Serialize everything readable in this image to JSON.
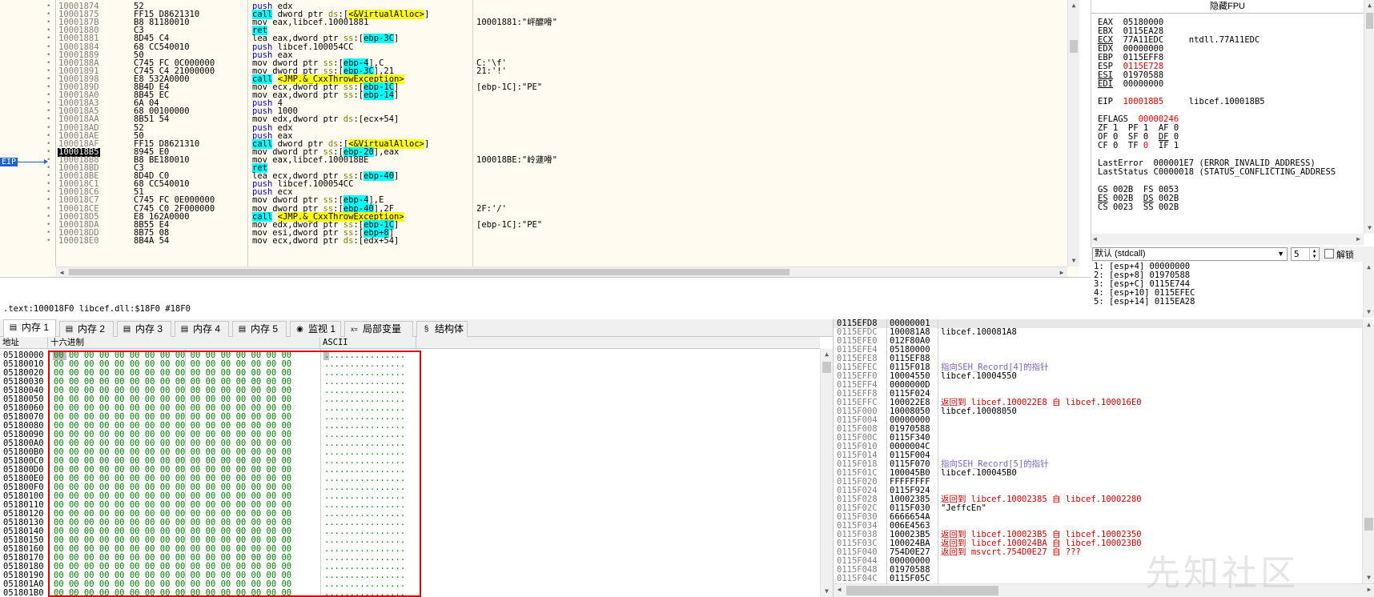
{
  "disasm": {
    "eip_tag": "EIP",
    "rows": [
      {
        "addr": "10001874",
        "bytes": "52",
        "asm": [
          [
            "push",
            "kw-push"
          ],
          [
            " edx",
            ""
          ]
        ],
        "cmt": ""
      },
      {
        "addr": "10001875",
        "bytes": "FF15 D8621310",
        "asm": [
          [
            "call",
            "kw-call"
          ],
          [
            " dword ptr ",
            ""
          ],
          [
            "ds",
            "seg"
          ],
          [
            ":[",
            ""
          ],
          [
            "<&VirtualAlloc>",
            "hl-yel"
          ],
          [
            "]",
            ""
          ]
        ],
        "cmt": ""
      },
      {
        "addr": "1000187B",
        "bytes": "B8 81180010",
        "asm": [
          [
            "mov eax,libcef.10001881",
            ""
          ]
        ],
        "cmt": "10001881:\"岼醿嗗\""
      },
      {
        "addr": "10001880",
        "bytes": "C3",
        "asm": [
          [
            "ret",
            "kw-ret"
          ]
        ],
        "cmt": ""
      },
      {
        "addr": "10001881",
        "bytes": "8D45 C4",
        "asm": [
          [
            "lea eax,dword ptr ",
            ""
          ],
          [
            "ss",
            "seg"
          ],
          [
            ":[",
            ""
          ],
          [
            "ebp-3C",
            "br"
          ],
          [
            "]",
            ""
          ]
        ],
        "cmt": ""
      },
      {
        "addr": "10001884",
        "bytes": "68 CC540010",
        "asm": [
          [
            "push",
            "kw-push"
          ],
          [
            " libcef.100054CC",
            ""
          ]
        ],
        "cmt": ""
      },
      {
        "addr": "10001889",
        "bytes": "50",
        "asm": [
          [
            "push",
            "kw-push"
          ],
          [
            " eax",
            ""
          ]
        ],
        "cmt": ""
      },
      {
        "addr": "1000188A",
        "bytes": "C745 FC 0C000000",
        "asm": [
          [
            "mov dword ptr ",
            ""
          ],
          [
            "ss",
            "seg"
          ],
          [
            ":[",
            ""
          ],
          [
            "ebp-4",
            "br"
          ],
          [
            "],C",
            ""
          ]
        ],
        "cmt": "C:'\\f'"
      },
      {
        "addr": "10001891",
        "bytes": "C745 C4 21000000",
        "asm": [
          [
            "mov dword ptr ",
            ""
          ],
          [
            "ss",
            "seg"
          ],
          [
            ":[",
            ""
          ],
          [
            "ebp-3C",
            "br"
          ],
          [
            "],21",
            ""
          ]
        ],
        "cmt": "21:'!'"
      },
      {
        "addr": "10001898",
        "bytes": "E8 532A0000",
        "asm": [
          [
            "call",
            "kw-call"
          ],
          [
            " ",
            ""
          ],
          [
            "<JMP.&_CxxThrowException>",
            "hl-yel"
          ]
        ],
        "cmt": ""
      },
      {
        "addr": "1000189D",
        "bytes": "8B4D E4",
        "asm": [
          [
            "mov ecx,dword ptr ",
            ""
          ],
          [
            "ss",
            "seg"
          ],
          [
            ":[",
            ""
          ],
          [
            "ebp-1C",
            "br"
          ],
          [
            "]",
            ""
          ]
        ],
        "cmt": "[ebp-1C]:\"PE\""
      },
      {
        "addr": "100018A0",
        "bytes": "8B45 EC",
        "asm": [
          [
            "mov eax,dword ptr ",
            ""
          ],
          [
            "ss",
            "seg"
          ],
          [
            ":[",
            ""
          ],
          [
            "ebp-14",
            "br"
          ],
          [
            "]",
            ""
          ]
        ],
        "cmt": ""
      },
      {
        "addr": "100018A3",
        "bytes": "6A 04",
        "asm": [
          [
            "push",
            "kw-push"
          ],
          [
            " 4",
            ""
          ]
        ],
        "cmt": ""
      },
      {
        "addr": "100018A5",
        "bytes": "68 00100000",
        "asm": [
          [
            "push",
            "kw-push"
          ],
          [
            " 1000",
            ""
          ]
        ],
        "cmt": ""
      },
      {
        "addr": "100018AA",
        "bytes": "8B51 54",
        "asm": [
          [
            "mov edx,dword ptr ",
            ""
          ],
          [
            "ds",
            "seg"
          ],
          [
            ":[ecx+54]",
            ""
          ]
        ],
        "cmt": ""
      },
      {
        "addr": "100018AD",
        "bytes": "52",
        "asm": [
          [
            "push",
            "kw-push"
          ],
          [
            " edx",
            ""
          ]
        ],
        "cmt": ""
      },
      {
        "addr": "100018AE",
        "bytes": "50",
        "asm": [
          [
            "push",
            "kw-push"
          ],
          [
            " eax",
            ""
          ]
        ],
        "cmt": ""
      },
      {
        "addr": "100018AF",
        "bytes": "FF15 D8621310",
        "asm": [
          [
            "call",
            "kw-call"
          ],
          [
            " dword ptr ",
            ""
          ],
          [
            "ds",
            "seg"
          ],
          [
            ":[",
            ""
          ],
          [
            "<&VirtualAlloc>",
            "hl-yel"
          ],
          [
            "]",
            ""
          ]
        ],
        "cmt": ""
      },
      {
        "addr": "100018B5",
        "bytes": "8945 E0",
        "asm": [
          [
            "mov dword ptr ",
            ""
          ],
          [
            "ss",
            "seg"
          ],
          [
            ":[",
            ""
          ],
          [
            "ebp-20",
            "br"
          ],
          [
            "],eax",
            ""
          ]
        ],
        "cmt": "",
        "current": true
      },
      {
        "addr": "100018B8",
        "bytes": "B8 BE180010",
        "asm": [
          [
            "mov eax,libcef.100018BE",
            ""
          ]
        ],
        "cmt": "100018BE:\"岭蘧嗗\""
      },
      {
        "addr": "100018BD",
        "bytes": "C3",
        "asm": [
          [
            "ret",
            "kw-ret"
          ]
        ],
        "cmt": ""
      },
      {
        "addr": "100018BE",
        "bytes": "8D4D C0",
        "asm": [
          [
            "lea ecx,dword ptr ",
            ""
          ],
          [
            "ss",
            "seg"
          ],
          [
            ":[",
            ""
          ],
          [
            "ebp-40",
            "br"
          ],
          [
            "]",
            ""
          ]
        ],
        "cmt": ""
      },
      {
        "addr": "100018C1",
        "bytes": "68 CC540010",
        "asm": [
          [
            "push",
            "kw-push"
          ],
          [
            " libcef.100054CC",
            ""
          ]
        ],
        "cmt": ""
      },
      {
        "addr": "100018C6",
        "bytes": "51",
        "asm": [
          [
            "push",
            "kw-push"
          ],
          [
            " ecx",
            ""
          ]
        ],
        "cmt": ""
      },
      {
        "addr": "100018C7",
        "bytes": "C745 FC 0E000000",
        "asm": [
          [
            "mov dword ptr ",
            ""
          ],
          [
            "ss",
            "seg"
          ],
          [
            ":[",
            ""
          ],
          [
            "ebp-4",
            "br"
          ],
          [
            "],E",
            ""
          ]
        ],
        "cmt": ""
      },
      {
        "addr": "100018CE",
        "bytes": "C745 C0 2F000000",
        "asm": [
          [
            "mov dword ptr ",
            ""
          ],
          [
            "ss",
            "seg"
          ],
          [
            ":[",
            ""
          ],
          [
            "ebp-40",
            "br"
          ],
          [
            "],2F",
            ""
          ]
        ],
        "cmt": "2F:'/'"
      },
      {
        "addr": "100018D5",
        "bytes": "E8 162A0000",
        "asm": [
          [
            "call",
            "kw-call"
          ],
          [
            " ",
            ""
          ],
          [
            "<JMP.&_CxxThrowException>",
            "hl-yel"
          ]
        ],
        "cmt": ""
      },
      {
        "addr": "100018DA",
        "bytes": "8B55 E4",
        "asm": [
          [
            "mov edx,dword ptr ",
            ""
          ],
          [
            "ss",
            "seg"
          ],
          [
            ":[",
            ""
          ],
          [
            "ebp-1C",
            "br"
          ],
          [
            "]",
            ""
          ]
        ],
        "cmt": "[ebp-1C]:\"PE\""
      },
      {
        "addr": "100018DD",
        "bytes": "8B75 08",
        "asm": [
          [
            "mov esi,dword ptr ",
            ""
          ],
          [
            "ss",
            "seg"
          ],
          [
            ":[",
            ""
          ],
          [
            "ebp+8",
            "br"
          ],
          [
            "]",
            ""
          ]
        ],
        "cmt": ""
      },
      {
        "addr": "100018E0",
        "bytes": "8B4A 54",
        "asm": [
          [
            "mov ecx,dword ptr ",
            ""
          ],
          [
            "ds",
            "seg"
          ],
          [
            ":[edx+54]",
            ""
          ]
        ],
        "cmt": ""
      }
    ]
  },
  "status_line": ".text:100018F0 libcef.dll:$18F0 #18F0",
  "registers": {
    "header": "隐藏FPU",
    "lines": [
      [
        [
          "EAX  ",
          ""
        ],
        [
          "05180000",
          ""
        ]
      ],
      [
        [
          "EBX  ",
          ""
        ],
        [
          "0115EA28",
          ""
        ]
      ],
      [
        [
          "ECX",
          "ul"
        ],
        [
          "  77A11EDC     ntdll.77A11EDC",
          ""
        ]
      ],
      [
        [
          "EDX  ",
          ""
        ],
        [
          "00000000",
          ""
        ]
      ],
      [
        [
          "EBP  ",
          ""
        ],
        [
          "0115EFF8",
          ""
        ]
      ],
      [
        [
          "ESP  ",
          ""
        ],
        [
          "0115E728",
          "red"
        ]
      ],
      [
        [
          "ESI",
          "ul"
        ],
        [
          "  01970588",
          ""
        ]
      ],
      [
        [
          "EDI",
          "ul"
        ],
        [
          "  00000000",
          ""
        ]
      ],
      [
        [
          "",
          ""
        ]
      ],
      [
        [
          "EIP  ",
          ""
        ],
        [
          "100018B5",
          "red"
        ],
        [
          "     libcef.100018B5",
          ""
        ]
      ],
      [
        [
          "",
          ""
        ]
      ],
      [
        [
          "EFLAGS  ",
          ""
        ],
        [
          "00000246",
          "red"
        ]
      ],
      [
        [
          "ZF 1  PF 1  AF 0",
          ""
        ]
      ],
      [
        [
          "OF 0  SF 0  ",
          ""
        ],
        [
          "DF",
          "ul"
        ],
        [
          " 0",
          ""
        ]
      ],
      [
        [
          "CF 0  TF ",
          ""
        ],
        [
          "0",
          "red"
        ],
        [
          "  IF 1",
          ""
        ]
      ],
      [
        [
          "",
          ""
        ]
      ],
      [
        [
          "LastError  000001E7 (ERROR_INVALID_ADDRESS)",
          ""
        ]
      ],
      [
        [
          "LastStatus C0000018 (STATUS_CONFLICTING_ADDRESS",
          ""
        ]
      ],
      [
        [
          "",
          ""
        ]
      ],
      [
        [
          "GS 002B  FS 0053",
          ""
        ]
      ],
      [
        [
          "ES",
          "ul"
        ],
        [
          " 002B  ",
          ""
        ],
        [
          "DS",
          "ul"
        ],
        [
          " 002B",
          ""
        ]
      ],
      [
        [
          "CS 0023  SS 002B",
          ""
        ]
      ]
    ]
  },
  "callconv": {
    "selected": "默认 (stdcall)",
    "count": "5",
    "unlock_label": "解锁"
  },
  "args": [
    "1: [esp+4] 00000000",
    "2: [esp+8] 01970588",
    "3: [esp+C] 0115E744",
    "4: [esp+10] 0115EFEC",
    "5: [esp+14] 0115EA28"
  ],
  "tabs": [
    {
      "label": "内存 1",
      "icon": "memory-icon",
      "active": true
    },
    {
      "label": "内存 2",
      "icon": "memory-icon"
    },
    {
      "label": "内存 3",
      "icon": "memory-icon"
    },
    {
      "label": "内存 4",
      "icon": "memory-icon"
    },
    {
      "label": "内存 5",
      "icon": "memory-icon"
    },
    {
      "label": "监视 1",
      "icon": "watch-icon"
    },
    {
      "label": "局部变量",
      "icon": "locals-icon"
    },
    {
      "label": "结构体",
      "icon": "struct-icon"
    }
  ],
  "dump": {
    "headers": {
      "addr": "地址",
      "hex": "十六进制",
      "ascii": "ASCII"
    },
    "hex": "00 00 00 00 00 00 00 00 00 00 00 00 00 00 00 00",
    "ascii": "................",
    "rows": [
      "05180000",
      "05180010",
      "05180020",
      "05180030",
      "05180040",
      "05180050",
      "05180060",
      "05180070",
      "05180080",
      "05180090",
      "051800A0",
      "051800B0",
      "051800C0",
      "051800D0",
      "051800E0",
      "051800F0",
      "05180100",
      "05180110",
      "05180120",
      "05180130",
      "05180140",
      "05180150",
      "05180160",
      "05180170",
      "05180180",
      "05180190",
      "051801A0",
      "051801B0"
    ]
  },
  "stack": [
    {
      "a": "0115EFD8",
      "v": "00000001",
      "c": "",
      "cls": ""
    },
    {
      "a": "0115EFDC",
      "v": "100081A8",
      "c": "libcef.100081A8",
      "cls": ""
    },
    {
      "a": "0115EFE0",
      "v": "012F80A0",
      "c": "",
      "cls": ""
    },
    {
      "a": "0115EFE4",
      "v": "05180000",
      "c": "",
      "cls": ""
    },
    {
      "a": "0115EFE8",
      "v": "0115EF88",
      "c": "",
      "cls": ""
    },
    {
      "a": "0115EFEC",
      "v": "0115F018",
      "c": "指向SEH_Record[4]的指针",
      "cls": "purple"
    },
    {
      "a": "0115EFF0",
      "v": "10004550",
      "c": "libcef.10004550",
      "cls": ""
    },
    {
      "a": "0115EFF4",
      "v": "0000000D",
      "c": "",
      "cls": ""
    },
    {
      "a": "0115EFF8",
      "v": "0115F024",
      "c": "",
      "cls": ""
    },
    {
      "a": "0115EFFC",
      "v": "100022E8",
      "c": "返回到 libcef.100022E8 自 libcef.100016E0",
      "cls": "red"
    },
    {
      "a": "0115F000",
      "v": "10008050",
      "c": "libcef.10008050",
      "cls": ""
    },
    {
      "a": "0115F004",
      "v": "00000000",
      "c": "",
      "cls": ""
    },
    {
      "a": "0115F008",
      "v": "01970588",
      "c": "",
      "cls": ""
    },
    {
      "a": "0115F00C",
      "v": "0115F340",
      "c": "",
      "cls": ""
    },
    {
      "a": "0115F010",
      "v": "0000004C",
      "c": "",
      "cls": ""
    },
    {
      "a": "0115F014",
      "v": "0115F004",
      "c": "",
      "cls": ""
    },
    {
      "a": "0115F018",
      "v": "0115F070",
      "c": "指向SEH_Record[5]的指针",
      "cls": "purple"
    },
    {
      "a": "0115F01C",
      "v": "100045B0",
      "c": "libcef.100045B0",
      "cls": ""
    },
    {
      "a": "0115F020",
      "v": "FFFFFFFF",
      "c": "",
      "cls": ""
    },
    {
      "a": "0115F024",
      "v": "0115F924",
      "c": "",
      "cls": ""
    },
    {
      "a": "0115F028",
      "v": "10002385",
      "c": "返回到 libcef.10002385 自 libcef.10002280",
      "cls": "red"
    },
    {
      "a": "0115F02C",
      "v": "0115F030",
      "c": "\"JeffcEn\"",
      "cls": ""
    },
    {
      "a": "0115F030",
      "v": "6666654A",
      "c": "",
      "cls": ""
    },
    {
      "a": "0115F034",
      "v": "006E4563",
      "c": "",
      "cls": ""
    },
    {
      "a": "0115F038",
      "v": "100023B5",
      "c": "返回到 libcef.100023B5 自 libcef.10002350",
      "cls": "red"
    },
    {
      "a": "0115F03C",
      "v": "100024BA",
      "c": "返回到 libcef.100024BA 自 libcef.100023B0",
      "cls": "red"
    },
    {
      "a": "0115F040",
      "v": "754D0E27",
      "c": "返回到 msvcrt.754D0E27 自 ???",
      "cls": "red"
    },
    {
      "a": "0115F044",
      "v": "00000000",
      "c": "",
      "cls": ""
    },
    {
      "a": "0115F048",
      "v": "01970588",
      "c": "",
      "cls": ""
    },
    {
      "a": "0115F04C",
      "v": "0115F05C",
      "c": "",
      "cls": ""
    }
  ],
  "watermark": "先知社区"
}
